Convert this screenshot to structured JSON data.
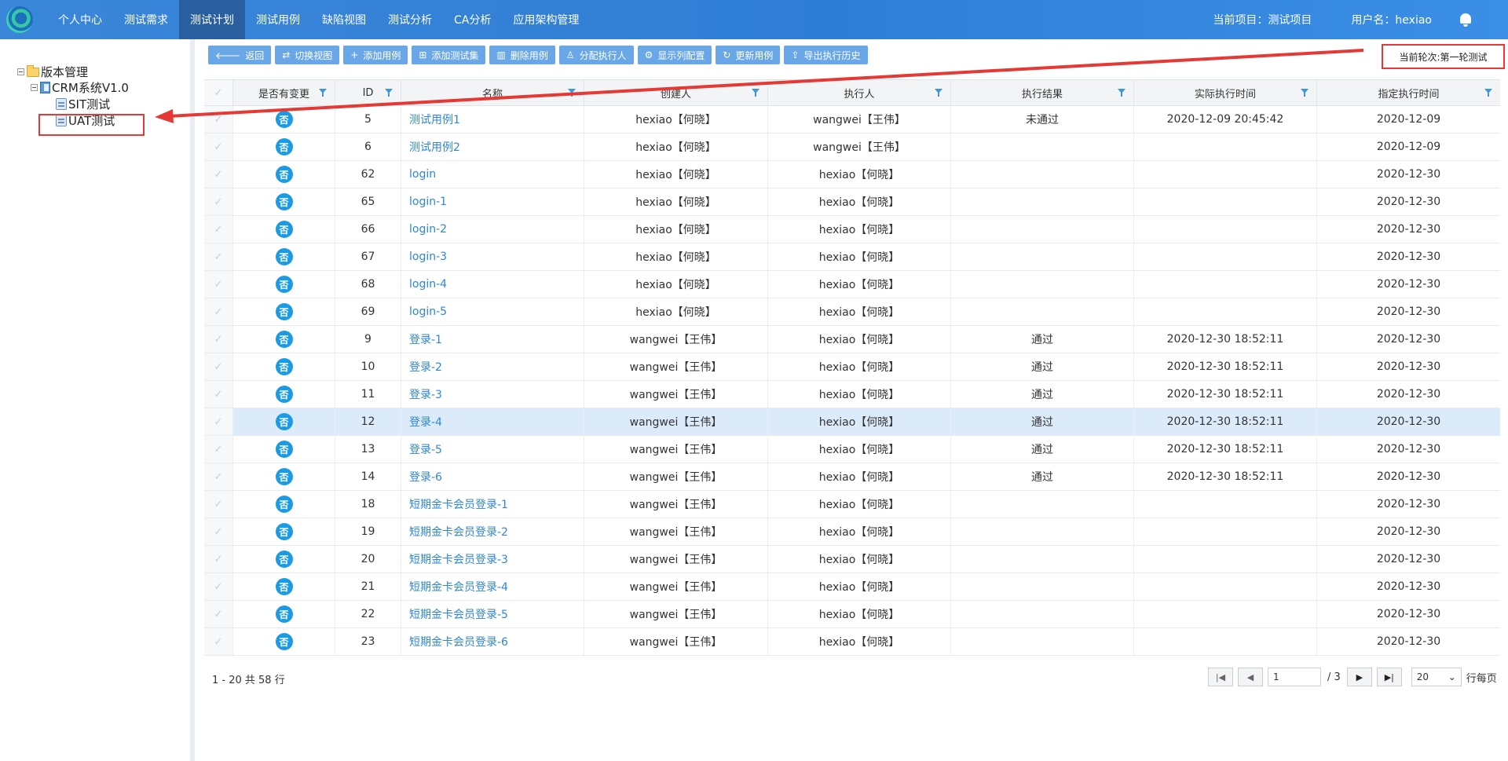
{
  "nav": {
    "items": [
      "个人中心",
      "测试需求",
      "测试计划",
      "测试用例",
      "缺陷视图",
      "测试分析",
      "CA分析",
      "应用架构管理"
    ],
    "active_index": 2,
    "current_project": "当前项目：测试项目",
    "username": "用户名：hexiao"
  },
  "tree": {
    "root": "版本管理",
    "version": "CRM系统V1.0",
    "children": [
      "SIT测试",
      "UAT测试"
    ]
  },
  "toolbar": {
    "back": "返回",
    "switch_view": "切换视图",
    "add_case": "添加用例",
    "add_suite": "添加测试集",
    "delete_case": "删除用例",
    "assign": "分配执行人",
    "columns": "显示列配置",
    "update_case": "更新用例",
    "export_history": "导出执行历史"
  },
  "round_label": "当前轮次:第一轮测试",
  "columns": [
    "是否有变更",
    "ID",
    "名称",
    "创建人",
    "执行人",
    "执行结果",
    "实际执行时间",
    "指定执行时间"
  ],
  "rows": [
    {
      "chg": "否",
      "id": "5",
      "name": "测试用例1",
      "creator": "hexiao【何晓】",
      "executor": "wangwei【王伟】",
      "result": "未通过",
      "actual": "2020-12-09 20:45:42",
      "due": "2020-12-09"
    },
    {
      "chg": "否",
      "id": "6",
      "name": "测试用例2",
      "creator": "hexiao【何晓】",
      "executor": "wangwei【王伟】",
      "result": "",
      "actual": "",
      "due": "2020-12-09"
    },
    {
      "chg": "否",
      "id": "62",
      "name": "login",
      "creator": "hexiao【何晓】",
      "executor": "hexiao【何晓】",
      "result": "",
      "actual": "",
      "due": "2020-12-30"
    },
    {
      "chg": "否",
      "id": "65",
      "name": "login-1",
      "creator": "hexiao【何晓】",
      "executor": "hexiao【何晓】",
      "result": "",
      "actual": "",
      "due": "2020-12-30"
    },
    {
      "chg": "否",
      "id": "66",
      "name": "login-2",
      "creator": "hexiao【何晓】",
      "executor": "hexiao【何晓】",
      "result": "",
      "actual": "",
      "due": "2020-12-30"
    },
    {
      "chg": "否",
      "id": "67",
      "name": "login-3",
      "creator": "hexiao【何晓】",
      "executor": "hexiao【何晓】",
      "result": "",
      "actual": "",
      "due": "2020-12-30"
    },
    {
      "chg": "否",
      "id": "68",
      "name": "login-4",
      "creator": "hexiao【何晓】",
      "executor": "hexiao【何晓】",
      "result": "",
      "actual": "",
      "due": "2020-12-30"
    },
    {
      "chg": "否",
      "id": "69",
      "name": "login-5",
      "creator": "hexiao【何晓】",
      "executor": "hexiao【何晓】",
      "result": "",
      "actual": "",
      "due": "2020-12-30"
    },
    {
      "chg": "否",
      "id": "9",
      "name": "登录-1",
      "creator": "wangwei【王伟】",
      "executor": "hexiao【何晓】",
      "result": "通过",
      "actual": "2020-12-30 18:52:11",
      "due": "2020-12-30"
    },
    {
      "chg": "否",
      "id": "10",
      "name": "登录-2",
      "creator": "wangwei【王伟】",
      "executor": "hexiao【何晓】",
      "result": "通过",
      "actual": "2020-12-30 18:52:11",
      "due": "2020-12-30"
    },
    {
      "chg": "否",
      "id": "11",
      "name": "登录-3",
      "creator": "wangwei【王伟】",
      "executor": "hexiao【何晓】",
      "result": "通过",
      "actual": "2020-12-30 18:52:11",
      "due": "2020-12-30"
    },
    {
      "chg": "否",
      "id": "12",
      "name": "登录-4",
      "creator": "wangwei【王伟】",
      "executor": "hexiao【何晓】",
      "result": "通过",
      "actual": "2020-12-30 18:52:11",
      "due": "2020-12-30",
      "selected": true
    },
    {
      "chg": "否",
      "id": "13",
      "name": "登录-5",
      "creator": "wangwei【王伟】",
      "executor": "hexiao【何晓】",
      "result": "通过",
      "actual": "2020-12-30 18:52:11",
      "due": "2020-12-30"
    },
    {
      "chg": "否",
      "id": "14",
      "name": "登录-6",
      "creator": "wangwei【王伟】",
      "executor": "hexiao【何晓】",
      "result": "通过",
      "actual": "2020-12-30 18:52:11",
      "due": "2020-12-30"
    },
    {
      "chg": "否",
      "id": "18",
      "name": "短期金卡会员登录-1",
      "creator": "wangwei【王伟】",
      "executor": "hexiao【何晓】",
      "result": "",
      "actual": "",
      "due": "2020-12-30"
    },
    {
      "chg": "否",
      "id": "19",
      "name": "短期金卡会员登录-2",
      "creator": "wangwei【王伟】",
      "executor": "hexiao【何晓】",
      "result": "",
      "actual": "",
      "due": "2020-12-30"
    },
    {
      "chg": "否",
      "id": "20",
      "name": "短期金卡会员登录-3",
      "creator": "wangwei【王伟】",
      "executor": "hexiao【何晓】",
      "result": "",
      "actual": "",
      "due": "2020-12-30"
    },
    {
      "chg": "否",
      "id": "21",
      "name": "短期金卡会员登录-4",
      "creator": "wangwei【王伟】",
      "executor": "hexiao【何晓】",
      "result": "",
      "actual": "",
      "due": "2020-12-30"
    },
    {
      "chg": "否",
      "id": "22",
      "name": "短期金卡会员登录-5",
      "creator": "wangwei【王伟】",
      "executor": "hexiao【何晓】",
      "result": "",
      "actual": "",
      "due": "2020-12-30"
    },
    {
      "chg": "否",
      "id": "23",
      "name": "短期金卡会员登录-6",
      "creator": "wangwei【王伟】",
      "executor": "hexiao【何晓】",
      "result": "",
      "actual": "",
      "due": "2020-12-30"
    }
  ],
  "footer": {
    "summary": "1 - 20 共 58 行",
    "page": "1",
    "total_pages": "/ 3",
    "page_size": "20",
    "per_page_label": "行每页"
  },
  "colors": {
    "accent": "#2f7ed6",
    "badge": "#1b9be6",
    "annotation": "#e53935"
  }
}
